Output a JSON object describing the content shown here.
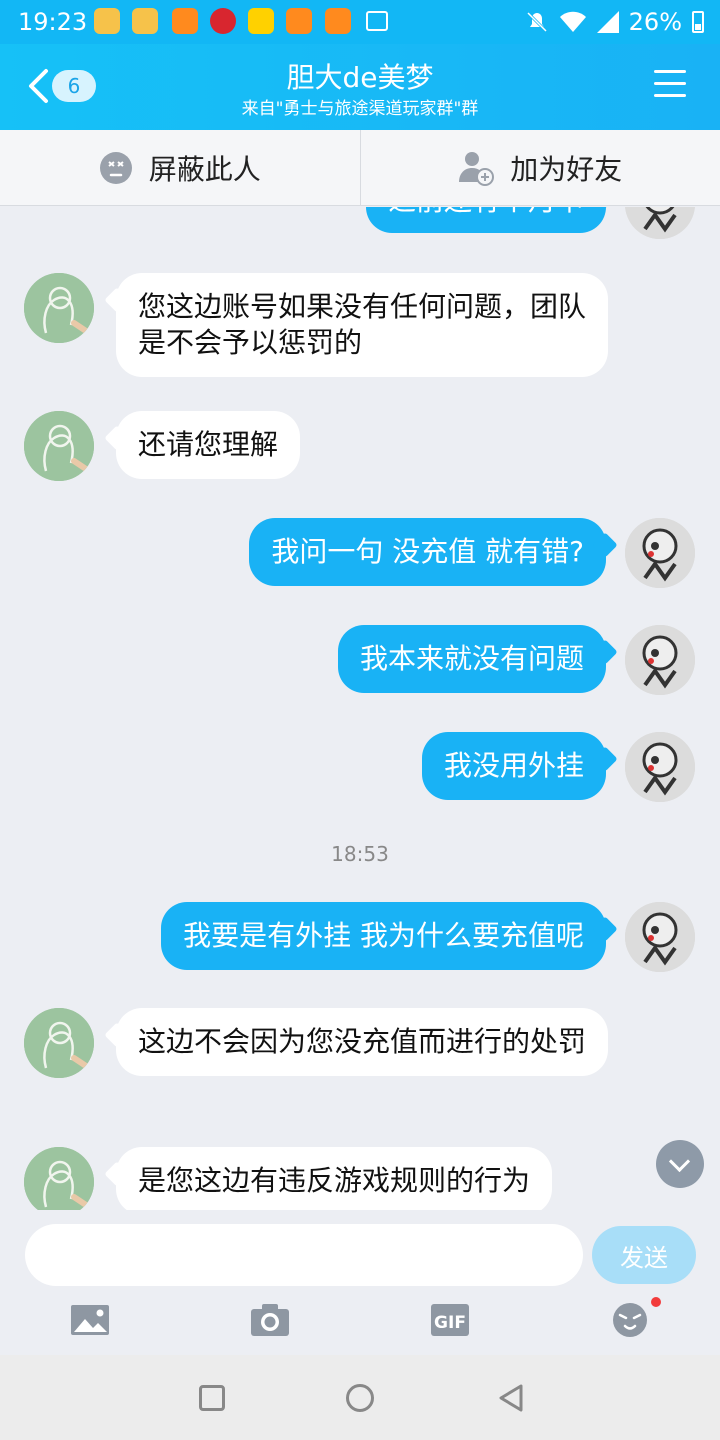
{
  "status_bar": {
    "time": "19:23",
    "battery": "26%",
    "notification_icons": [
      "app-icon-1",
      "app-icon-2",
      "app-icon-3",
      "citic-icon",
      "meituan-icon",
      "app-icon-4",
      "app-icon-5",
      "image-icon"
    ]
  },
  "header": {
    "back_count": "6",
    "title": "胆大de美梦",
    "subtitle": "来自\"勇士与旅途渠道玩家群\"群"
  },
  "actions": {
    "block_label": "屏蔽此人",
    "add_friend_label": "加为好友"
  },
  "messages": [
    {
      "side": "right",
      "text": "之前还有个月卡"
    },
    {
      "side": "left",
      "text": "您这边账号如果没有任何问题，团队是不会予以惩罚的"
    },
    {
      "side": "left",
      "text": "还请您理解"
    },
    {
      "side": "right",
      "text": "我问一句 没充值 就有错?"
    },
    {
      "side": "right",
      "text": "我本来就没有问题"
    },
    {
      "side": "right",
      "text": "我没用外挂"
    },
    {
      "side": "time",
      "text": "18:53"
    },
    {
      "side": "right",
      "text": "我要是有外挂 我为什么要充值呢"
    },
    {
      "side": "left",
      "text": "这边不会因为您没充值而进行的处罚"
    },
    {
      "side": "left",
      "text": "是您这边有违反游戏规则的行为"
    }
  ],
  "input": {
    "value": "",
    "send_label": "发送"
  },
  "colors": {
    "accent": "#19b2f5",
    "send_disabled": "#a8def8"
  }
}
